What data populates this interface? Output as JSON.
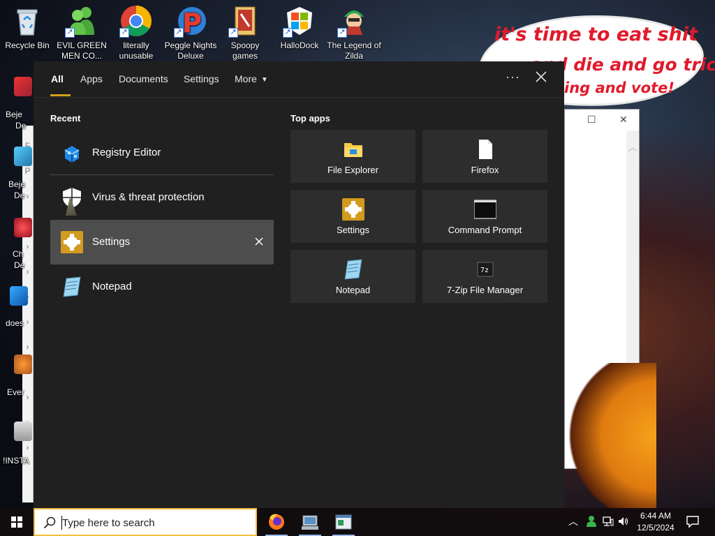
{
  "desktop": {
    "icons": [
      {
        "label": "Recycle Bin",
        "icon": "recycle-bin-icon"
      },
      {
        "label": "EVIL GREEN MEN CO...",
        "icon": "green-men-icon"
      },
      {
        "label": "literally unusable",
        "icon": "chrome-icon"
      },
      {
        "label": "Peggle Nights Deluxe",
        "icon": "peggle-icon"
      },
      {
        "label": "Spoopy games",
        "icon": "folder-games-icon"
      },
      {
        "label": "HalloDock",
        "icon": "windows-logo-icon"
      },
      {
        "label": "The Legend of Zilda",
        "icon": "zilda-icon"
      }
    ],
    "edge_labels": [
      "Beje",
      "De",
      "Beje",
      "De",
      "Ch",
      "De",
      "does",
      "Ever",
      "!INSTA"
    ],
    "bubble_lines": [
      "it's time to eat shit",
      "and die and go trick",
      "ing and vote!"
    ]
  },
  "search_panel": {
    "tabs": [
      "All",
      "Apps",
      "Documents",
      "Settings",
      "More"
    ],
    "active_tab": "All",
    "recent_title": "Recent",
    "recent": [
      {
        "label": "Registry Editor",
        "icon": "registry-editor-icon"
      },
      {
        "label": "Virus & threat protection",
        "icon": "shield-icon"
      },
      {
        "label": "Settings",
        "icon": "settings-gear-icon"
      },
      {
        "label": "Notepad",
        "icon": "notepad-icon"
      }
    ],
    "top_apps_title": "Top apps",
    "top_apps": [
      {
        "label": "File Explorer",
        "icon": "file-explorer-icon"
      },
      {
        "label": "Firefox",
        "icon": "blank-document-icon"
      },
      {
        "label": "Settings",
        "icon": "settings-gear-icon"
      },
      {
        "label": "Command Prompt",
        "icon": "command-prompt-icon"
      },
      {
        "label": "Notepad",
        "icon": "notepad-icon"
      },
      {
        "label": "7-Zip File Manager",
        "icon": "seven-zip-icon"
      }
    ]
  },
  "taskbar": {
    "search_placeholder": "Type here to search",
    "time": "6:44 AM",
    "date": "12/5/2024"
  },
  "colors": {
    "accent": "#d4a017",
    "panel_bg": "#202020",
    "tile_bg": "#2d2d2d",
    "highlight": "#4d4d4d",
    "bubble_text": "#e01a2c"
  }
}
